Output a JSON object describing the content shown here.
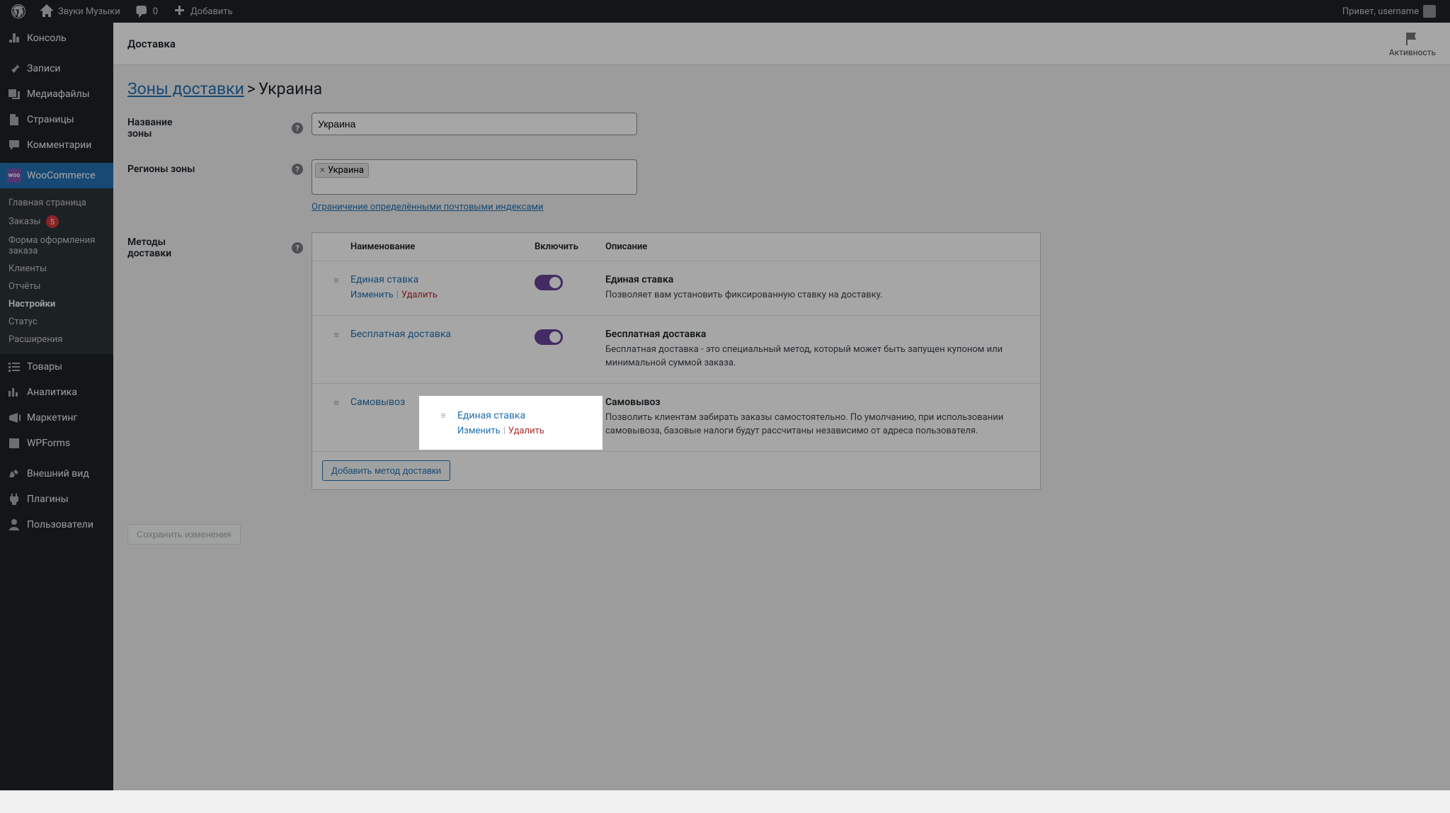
{
  "adminbar": {
    "site_name": "Звуки Музыки",
    "comments_count": "0",
    "add_new": "Добавить",
    "greeting": "Привет, username"
  },
  "sidebar": {
    "items": [
      {
        "label": "Консоль"
      },
      {
        "label": "Записи"
      },
      {
        "label": "Медиафайлы"
      },
      {
        "label": "Страницы"
      },
      {
        "label": "Комментарии"
      },
      {
        "label": "WooCommerce"
      },
      {
        "label": "Товары"
      },
      {
        "label": "Аналитика"
      },
      {
        "label": "Маркетинг"
      },
      {
        "label": "WPForms"
      },
      {
        "label": "Внешний вид"
      },
      {
        "label": "Плагины"
      },
      {
        "label": "Пользователи"
      }
    ],
    "woo_submenu": {
      "home": "Главная страница",
      "orders": "Заказы",
      "orders_badge": "5",
      "checkout_form": "Форма оформления заказа",
      "customers": "Клиенты",
      "reports": "Отчёты",
      "settings": "Настройки",
      "status": "Статус",
      "extensions": "Расширения"
    }
  },
  "header": {
    "title": "Доставка",
    "activity": "Активность"
  },
  "breadcrumb": {
    "zones_link": "Зоны доставки",
    "current": "Украина"
  },
  "form": {
    "zone_name_label": "Название зоны",
    "zone_name_value": "Украина",
    "zone_regions_label": "Регионы зоны",
    "region_chip": "Украина",
    "postcode_limit_link": "Ограничение определёнными почтовыми индексами",
    "methods_label": "Методы доставки"
  },
  "table": {
    "col_name": "Наименование",
    "col_enable": "Включить",
    "col_desc": "Описание",
    "add_method_btn": "Добавить метод доставки",
    "methods": [
      {
        "name": "Единая ставка",
        "edit": "Изменить",
        "delete": "Удалить",
        "desc_title": "Единая ставка",
        "desc_text": "Позволяет вам установить фиксированную ставку на доставку."
      },
      {
        "name": "Бесплатная доставка",
        "desc_title": "Бесплатная доставка",
        "desc_text": "Бесплатная доставка - это специальный метод, который может быть запущен купоном или минимальной суммой заказа."
      },
      {
        "name": "Самовывоз",
        "desc_title": "Самовывоз",
        "desc_text": "Позволить клиентам забирать заказы самостоятельно. По умолчанию, при использовании самовывоза, базовые налоги будут рассчитаны независимо от адреса пользователя."
      }
    ]
  },
  "save_btn": "Сохранить изменения"
}
